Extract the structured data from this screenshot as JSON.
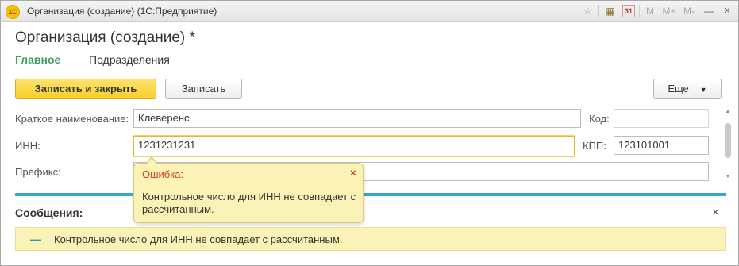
{
  "window": {
    "title": "Организация (создание)  (1С:Предприятие)",
    "logo_text": "1С",
    "toolbar_icons": [
      "star-icon",
      "calculator-icon",
      "calendar-icon",
      "memory-m-icon",
      "memory-plus-icon",
      "memory-minus-icon",
      "minimize-icon",
      "maximize-icon",
      "close-icon"
    ],
    "calendar_label": "31",
    "m_label": "M",
    "m_plus_label": "M+",
    "m_minus_label": "M-",
    "minimize_label": "—",
    "maximize_label": "□",
    "close_label": "×"
  },
  "form": {
    "title": "Организация (создание) *",
    "tabs": [
      {
        "label": "Главное",
        "active": true
      },
      {
        "label": "Подразделения",
        "active": false
      }
    ]
  },
  "toolbar": {
    "save_close_label": "Записать и закрыть",
    "save_label": "Записать",
    "more_label": "Еще",
    "more_arrow": "▼"
  },
  "fields": {
    "short_name": {
      "label": "Краткое наименование:",
      "value": "Клеверенс"
    },
    "code": {
      "label": "Код:",
      "value": ""
    },
    "inn": {
      "label": "ИНН:",
      "value": "1231231231"
    },
    "kpp": {
      "label": "КПП:",
      "value": "123101001"
    },
    "prefix": {
      "label": "Префикс:",
      "value": ""
    }
  },
  "tooltip": {
    "title": "Ошибка:",
    "text": "Контрольное число для ИНН не совпадает с рассчитанным.",
    "close": "×"
  },
  "messages": {
    "title": "Сообщения:",
    "close": "×",
    "items": [
      {
        "marker": "—",
        "text": "Контрольное число для ИНН не совпадает с рассчитанным."
      }
    ]
  },
  "colors": {
    "accent_green": "#3fa05a",
    "primary_yellow": "#f7cf2c",
    "message_bg": "#fbf3b6",
    "error_red": "#d3421f",
    "separator_blue": "#33a7d6"
  }
}
